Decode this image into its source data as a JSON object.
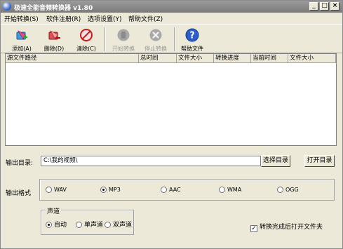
{
  "window": {
    "title": "极速全能音频转换器 v1.80"
  },
  "menu": [
    "开始转换(S)",
    "软件注册(R)",
    "选项设置(Y)",
    "帮助文件(Z)"
  ],
  "toolbar": {
    "add": "添加(A)",
    "delete": "删除(D)",
    "clear": "清除(C)",
    "start": "开始转换",
    "stop": "停止转换",
    "help": "帮助文件"
  },
  "list": {
    "columns": [
      "源文件路径",
      "总时间",
      "文件大小",
      "转换进度",
      "当前时间",
      "文件大小"
    ]
  },
  "output": {
    "dir_label": "输出目录:",
    "dir_value": "C:\\我的视频\\",
    "choose_button": "选择目录",
    "open_button": "打开目录",
    "format_label": "输出格式",
    "formats": [
      "WAV",
      "MP3",
      "AAC",
      "WMA",
      "OGG"
    ],
    "selected_format": "MP3",
    "channel_group_label": "声道",
    "channels": [
      "自动",
      "单声道",
      "双声道"
    ],
    "selected_channel": "自动",
    "open_after_label": "转换完成后打开文件夹",
    "open_after_checked": true
  }
}
